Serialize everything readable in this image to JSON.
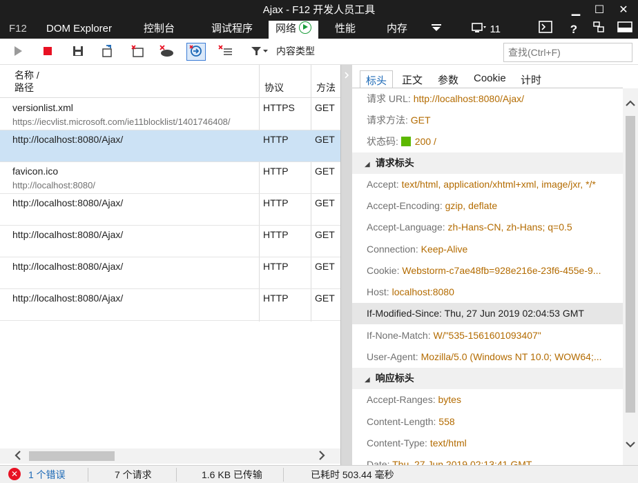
{
  "window": {
    "title": "Ajax - F12 开发人员工具",
    "minimize": "▁",
    "maximize": "☐",
    "close": "✕"
  },
  "tabs": {
    "f12": "F12",
    "dom": "DOM Explorer",
    "console": "控制台",
    "debugger": "调试程序",
    "network": "网络",
    "performance": "性能",
    "memory": "内存",
    "more": "▼",
    "emulation_count": "11",
    "help": "?",
    "icons": [
      "menu-chevron-icon",
      "emulation-icon",
      "console-toggle-icon",
      "help-icon",
      "pin-icon",
      "dock-icon"
    ]
  },
  "toolbar": {
    "filter_label": "内容类型",
    "search_placeholder": "查找(Ctrl+F)",
    "icons": [
      "play-icon",
      "stop-icon",
      "save-icon",
      "import-icon",
      "clear-icon",
      "clear-cache-icon",
      "always-refresh-icon",
      "clear-entries-icon",
      "filter-icon"
    ]
  },
  "list": {
    "headers": {
      "name_line1": "名称 /",
      "name_line2": "路径",
      "protocol": "协议",
      "method": "方法"
    },
    "rows": [
      {
        "name": "versionlist.xml",
        "path": "https://iecvlist.microsoft.com/ie11blocklist/1401746408/",
        "protocol": "HTTPS",
        "method": "GET"
      },
      {
        "name": "http://localhost:8080/Ajax/",
        "path": "",
        "protocol": "HTTP",
        "method": "GET"
      },
      {
        "name": "favicon.ico",
        "path": "http://localhost:8080/",
        "protocol": "HTTP",
        "method": "GET"
      },
      {
        "name": "http://localhost:8080/Ajax/",
        "path": "",
        "protocol": "HTTP",
        "method": "GET"
      },
      {
        "name": "http://localhost:8080/Ajax/",
        "path": "",
        "protocol": "HTTP",
        "method": "GET"
      },
      {
        "name": "http://localhost:8080/Ajax/",
        "path": "",
        "protocol": "HTTP",
        "method": "GET"
      },
      {
        "name": "http://localhost:8080/Ajax/",
        "path": "",
        "protocol": "HTTP",
        "method": "GET"
      }
    ]
  },
  "details": {
    "tabs": [
      "标头",
      "正文",
      "参数",
      "Cookie",
      "计时"
    ],
    "summary": [
      {
        "k": "请求 URL: ",
        "v": "http://localhost:8080/Ajax/"
      },
      {
        "k": "请求方法: ",
        "v": "GET"
      },
      {
        "k": "状态码: ",
        "v": "200 /"
      }
    ],
    "request_headers_title": "请求标头",
    "request_headers": [
      {
        "k": "Accept: ",
        "v": "text/html, application/xhtml+xml, image/jxr, */*"
      },
      {
        "k": "Accept-Encoding: ",
        "v": "gzip, deflate"
      },
      {
        "k": "Accept-Language: ",
        "v": "zh-Hans-CN, zh-Hans; q=0.5"
      },
      {
        "k": "Connection: ",
        "v": "Keep-Alive"
      },
      {
        "k": "Cookie: ",
        "v": "Webstorm-c7ae48fb=928e216e-23f6-455e-9..."
      },
      {
        "k": "Host: ",
        "v": "localhost:8080"
      },
      {
        "k": "If-Modified-Since: ",
        "v": "Thu, 27 Jun 2019 02:04:53 GMT"
      },
      {
        "k": "If-None-Match: ",
        "v": "W/\"535-1561601093407\""
      },
      {
        "k": "User-Agent: ",
        "v": "Mozilla/5.0 (Windows NT 10.0; WOW64;..."
      }
    ],
    "response_headers_title": "响应标头",
    "response_headers": [
      {
        "k": "Accept-Ranges: ",
        "v": "bytes"
      },
      {
        "k": "Content-Length: ",
        "v": "558"
      },
      {
        "k": "Content-Type: ",
        "v": "text/html"
      },
      {
        "k": "Date: ",
        "v": "Thu, 27 Jun 2019 02:13:41 GMT"
      }
    ]
  },
  "status": {
    "errors": "1 个错误",
    "requests": "7 个请求",
    "transferred": "1.6 KB 已传输",
    "elapsed": "已耗时 503.44 毫秒"
  },
  "colors": {
    "accent": "#1a67b5",
    "value": "#b36b00",
    "selected_row": "#cce2f5",
    "status_ok": "#5cb800",
    "error": "#e81123"
  }
}
